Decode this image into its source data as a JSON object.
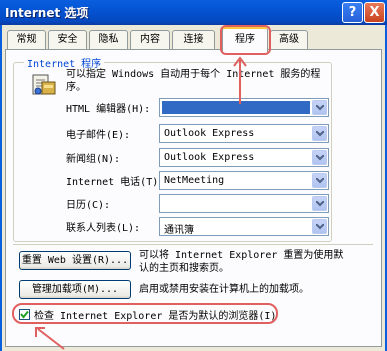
{
  "window": {
    "title": "Internet 选项",
    "help_glyph": "?",
    "close_glyph": "X"
  },
  "tabs": [
    {
      "label": "常规",
      "active": false
    },
    {
      "label": "安全",
      "active": false
    },
    {
      "label": "隐私",
      "active": false
    },
    {
      "label": "内容",
      "active": false
    },
    {
      "label": "连接",
      "active": false
    },
    {
      "label": "程序",
      "active": true
    },
    {
      "label": "高级",
      "active": false
    }
  ],
  "programs_group": {
    "legend": "Internet 程序",
    "description": "可以指定 Windows 自动用于每个 Internet 服务的程序。",
    "icon": "programs-icon",
    "rows": [
      {
        "label": "HTML 编辑器(H):",
        "value": "",
        "selected": true
      },
      {
        "label": "电子邮件(E):",
        "value": "Outlook Express",
        "selected": false
      },
      {
        "label": "新闻组(N):",
        "value": "Outlook Express",
        "selected": false
      },
      {
        "label": "Internet 电话(T):",
        "value": "NetMeeting",
        "selected": false
      },
      {
        "label": "日历(C):",
        "value": "",
        "selected": false
      },
      {
        "label": "联系人列表(L):",
        "value": "通讯簿",
        "selected": false
      }
    ]
  },
  "reset_web": {
    "button": "重置 Web 设置(R)...",
    "description_line1": "可以将 Internet Explorer 重置为使用默",
    "description_line2": "认的主页和搜索页。"
  },
  "manage_addons": {
    "button": "管理加载项(M)...",
    "description": "启用或禁用安装在计算机上的加载项。"
  },
  "default_browser_check": {
    "label": "检查 Internet Explorer 是否为默认的浏览器(I)",
    "checked": true
  },
  "colors": {
    "titlebar": "#0454d3",
    "highlight_annotation": "#e06060",
    "legend_text": "#0046d5",
    "selection": "#316ac5"
  }
}
